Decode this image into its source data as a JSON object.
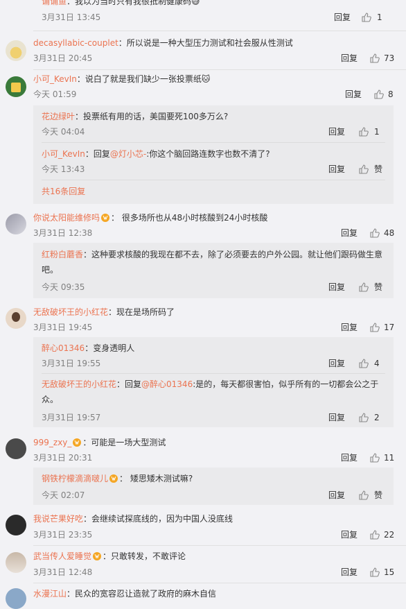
{
  "comments": [
    {
      "name": "诵诵鱼",
      "text": "：我以为当时只有我很抵制健康码😅",
      "time": "3月31日 13:45",
      "reply": "回复",
      "likes": "1"
    },
    {
      "name": "decasyllabic-couplet",
      "text": "：所以说是一种大型压力测试和社会服从性测试",
      "time": "3月31日 20:45",
      "reply": "回复",
      "likes": "73"
    },
    {
      "name": "小可_KevIn",
      "text": "：说白了就是我们缺少一张投票纸🐱",
      "time": "今天 01:59",
      "reply": "回复",
      "likes": "8"
    },
    {
      "name": "你说太阳能维修吗",
      "text": "： 很多场所也从48小时核酸到24小时核酸",
      "time": "3月31日 12:38",
      "reply": "回复",
      "likes": "48"
    },
    {
      "name": "无敌破坏王的小红花",
      "text": "：现在是场所码了",
      "time": "3月31日 19:45",
      "reply": "回复",
      "likes": "17"
    },
    {
      "name": "999_zxy_",
      "text": "：可能是一场大型测试",
      "time": "3月31日 20:31",
      "reply": "回复",
      "likes": "11"
    },
    {
      "name": "我说芒果好吃",
      "text": "：会继续试探底线的，因为中国人没底线",
      "time": "3月31日 23:35",
      "reply": "回复",
      "likes": "22"
    },
    {
      "name": "武当传人爱睡觉",
      "text": "：只敢转发，不敢评论",
      "time": "3月31日 12:48",
      "reply": "回复",
      "likes": "15"
    },
    {
      "name": "水漫江山",
      "text": "：民众的宽容忍让造就了政府的麻木自信"
    }
  ],
  "subs": {
    "c2": [
      {
        "name": "花边绿叶",
        "text": "：投票纸有用的话，美国要死100多万么?",
        "time": "今天 04:04",
        "reply": "回复",
        "likes": "1"
      },
      {
        "name": "小可_KevIn",
        "text_pre": "：回复",
        "mention": "@灯小芯-",
        "text": ":你这个脑回路连数字也数不清了?",
        "time": "今天 13:43",
        "reply": "回复",
        "likes": "赞"
      }
    ],
    "c2_more": "共16条回复",
    "c3": [
      {
        "name": "红粉白蘑香",
        "text": "：这种要求核酸的我现在都不去，除了必须要去的户外公园。就让他们跟码做生意吧。",
        "time": "今天 09:35",
        "reply": "回复",
        "likes": "赞"
      }
    ],
    "c4": [
      {
        "name": "醉心01346",
        "text": "：变身透明人",
        "time": "3月31日 19:55",
        "reply": "回复",
        "likes": "4"
      },
      {
        "name": "无敌破坏王的小红花",
        "text_pre": "：回复",
        "mention": "@醉心01346",
        "text": ":是的，每天都很害怕，似乎所有的一切都会公之于众。",
        "time": "3月31日 19:57",
        "reply": "回复",
        "likes": "2"
      }
    ],
    "c5": [
      {
        "name": "钢铁柠檬滴滴啵儿",
        "text": "： 矮思矮木测试嘛?",
        "time": "今天 02:07",
        "reply": "回复",
        "likes": "赞"
      }
    ]
  },
  "colors": {
    "name": "#eb7350",
    "bg": "#f2f2f5",
    "subbg": "#eaeaec"
  },
  "icons": {
    "like": "thumbs-up-icon",
    "badge": "vip-badge-icon"
  }
}
